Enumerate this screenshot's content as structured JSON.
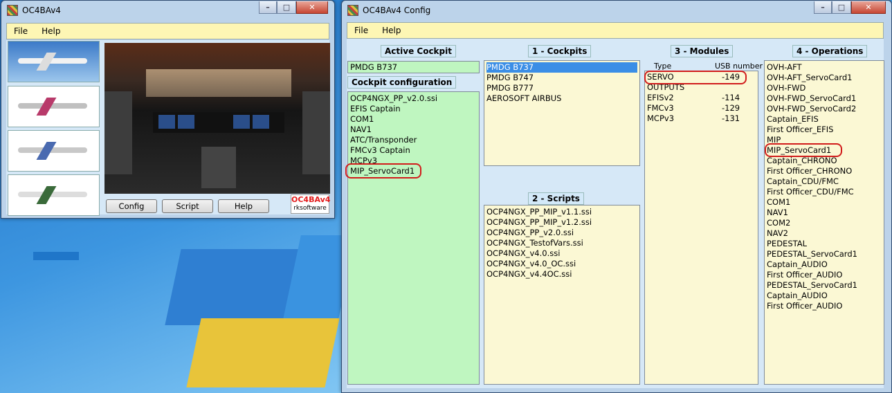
{
  "main_window": {
    "title": "OC4BAv4",
    "menu": [
      "File",
      "Help"
    ],
    "buttons": {
      "config": "Config",
      "script": "Script",
      "help": "Help"
    },
    "logo": {
      "name": "OC4BAv4",
      "publisher": "rksoftware"
    },
    "thumbnails": [
      "plane-thumbnail-1",
      "plane-thumbnail-2",
      "plane-thumbnail-3",
      "plane-thumbnail-4"
    ]
  },
  "config_window": {
    "title": "OC4BAv4 Config",
    "menu": [
      "File",
      "Help"
    ],
    "active_cockpit": {
      "header": "Active Cockpit",
      "value": "PMDG B737"
    },
    "cockpit_configuration": {
      "header": "Cockpit configuration",
      "items": [
        "OCP4NGX_PP_v2.0.ssi",
        "EFIS Captain",
        "COM1",
        "NAV1",
        "ATC/Transponder",
        "FMCv3 Captain",
        "MCPv3",
        "MIP_ServoCard1"
      ]
    },
    "cockpits": {
      "header": "1 - Cockpits",
      "items": [
        "PMDG B737",
        "PMDG B747",
        "PMDG B777",
        "AEROSOFT AIRBUS"
      ],
      "selected_index": 0
    },
    "scripts": {
      "header": "2 - Scripts",
      "items": [
        "OCP4NGX_PP_MIP_v1.1.ssi",
        "OCP4NGX_PP_MIP_v1.2.ssi",
        "OCP4NGX_PP_v2.0.ssi",
        "OCP4NGX_TestofVars.ssi",
        "OCP4NGX_v4.0.ssi",
        "OCP4NGX_v4.0_OC.ssi",
        "OCP4NGX_v4.4OC.ssi"
      ]
    },
    "modules": {
      "header": "3 - Modules",
      "col_type": "Type",
      "col_usb": "USB number",
      "rows": [
        {
          "type": "SERVO",
          "usb": "-149"
        },
        {
          "type": "OUTPUTS",
          "usb": ""
        },
        {
          "type": "EFISv2",
          "usb": "-114"
        },
        {
          "type": "FMCv3",
          "usb": "-129"
        },
        {
          "type": "MCPv3",
          "usb": "-131"
        }
      ]
    },
    "operations": {
      "header": "4 - Operations",
      "items": [
        "OVH-AFT",
        "OVH-AFT_ServoCard1",
        "OVH-FWD",
        "OVH-FWD_ServoCard1",
        "OVH-FWD_ServoCard2",
        "Captain_EFIS",
        "First Officer_EFIS",
        "MIP",
        "MIP_ServoCard1",
        "Captain_CHRONO",
        "First Officer_CHRONO",
        "Captain_CDU/FMC",
        "First Officer_CDU/FMC",
        "COM1",
        "NAV1",
        "COM2",
        "NAV2",
        "PEDESTAL",
        "PEDESTAL_ServoCard1",
        "Captain_AUDIO",
        "First Officer_AUDIO",
        "PEDESTAL_ServoCard1",
        "Captain_AUDIO",
        "First Officer_AUDIO"
      ]
    }
  },
  "colors": {
    "panel_pale": "#fbf8d4",
    "panel_green": "#bff6c0",
    "selection": "#3b8ee6",
    "highlight_circle": "#d11b1b"
  }
}
